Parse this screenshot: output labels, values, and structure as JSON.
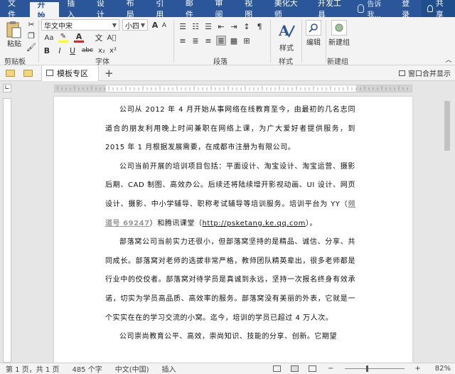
{
  "ribbon_tabs": [
    "文件",
    "开始",
    "插入",
    "设计",
    "布局",
    "引用",
    "邮件",
    "审阅",
    "视图",
    "美化大师",
    "开发工具"
  ],
  "active_tab": "开始",
  "tell_me": "告诉我...",
  "login": "登录",
  "share": "共享",
  "clipboard": {
    "paste": "粘贴",
    "label": "剪贴板"
  },
  "font": {
    "name": "华文中宋",
    "size": "小四",
    "label": "字体",
    "grow": "A",
    "shrink": "A",
    "case": "Aa",
    "bold": "B",
    "italic": "I",
    "underline": "U",
    "strike": "abc",
    "sub": "x₂",
    "sup": "x²",
    "color_a": "A",
    "wen": "文"
  },
  "paragraph": {
    "label": "段落"
  },
  "styles": {
    "label": "样式"
  },
  "editing": {
    "label": "编辑"
  },
  "new_group": {
    "label": "新建组"
  },
  "quickbar": {
    "template_tab": "模板专区",
    "window_merge": "窗口合并显示"
  },
  "document": {
    "paragraphs": [
      {
        "text": "公司从 2012 年 4 月开始从事网络在线教育至今，由最初的几名志同道合的朋友利用晚上时间兼职在网络上课，为广大爱好者提供服务，到 2015 年 1 月根据发展需要，在成都市注册为有限公司。"
      },
      {
        "pre": "公司当前开展的培训项目包括：平面设计、淘宝设计、淘宝运营、摄影后期、CAD 制图、高效办公。后续还将陆续增开影视动画、UI 设计、网页设计、摄影、中小学辅导、职称考试辅导等培训服务。培训平台为 YY（",
        "hl": "频道号 69247",
        "mid": "）和腾讯课堂（",
        "url": "http://psketang.ke.qq.com",
        "post": "）。"
      },
      {
        "text": "部落窝公司当前实力还很小，但部落窝坚持的是精品、诚信、分享、共同成长。部落窝对老师的选拔非常严格，教师团队精英辈出，很多老师都是行业中的佼佼者。部落窝对待学员是真诚到永远，坚持一次报名终身有效承诺，切实为学员高品质、高效率的服务。部落窝没有美丽的外表，它就是一个实实在在的学习交流的小窝。迄今，培训的学员已超过 4 万人次。"
      },
      {
        "text": "公司崇尚教育公平、高效，崇尚知识、技能的分享、创新。它期望"
      }
    ]
  },
  "status": {
    "page": "第 1 页，共 1 页",
    "words": "485 个字",
    "lang": "中文(中国)",
    "mode": "插入",
    "zoom": "82%",
    "zoom_minus": "−",
    "zoom_plus": "+"
  },
  "icons": {
    "clipboard": "clipboard-icon",
    "cut": "scissors-icon",
    "copy": "copy-icon",
    "brush": "format-painter-icon",
    "styles": "styles-icon",
    "search": "search-icon",
    "new_group": "circle-icon"
  },
  "colors": {
    "accent": "#2b579a",
    "highlight_yellow": "#ffff00",
    "font_red": "#e02020"
  }
}
